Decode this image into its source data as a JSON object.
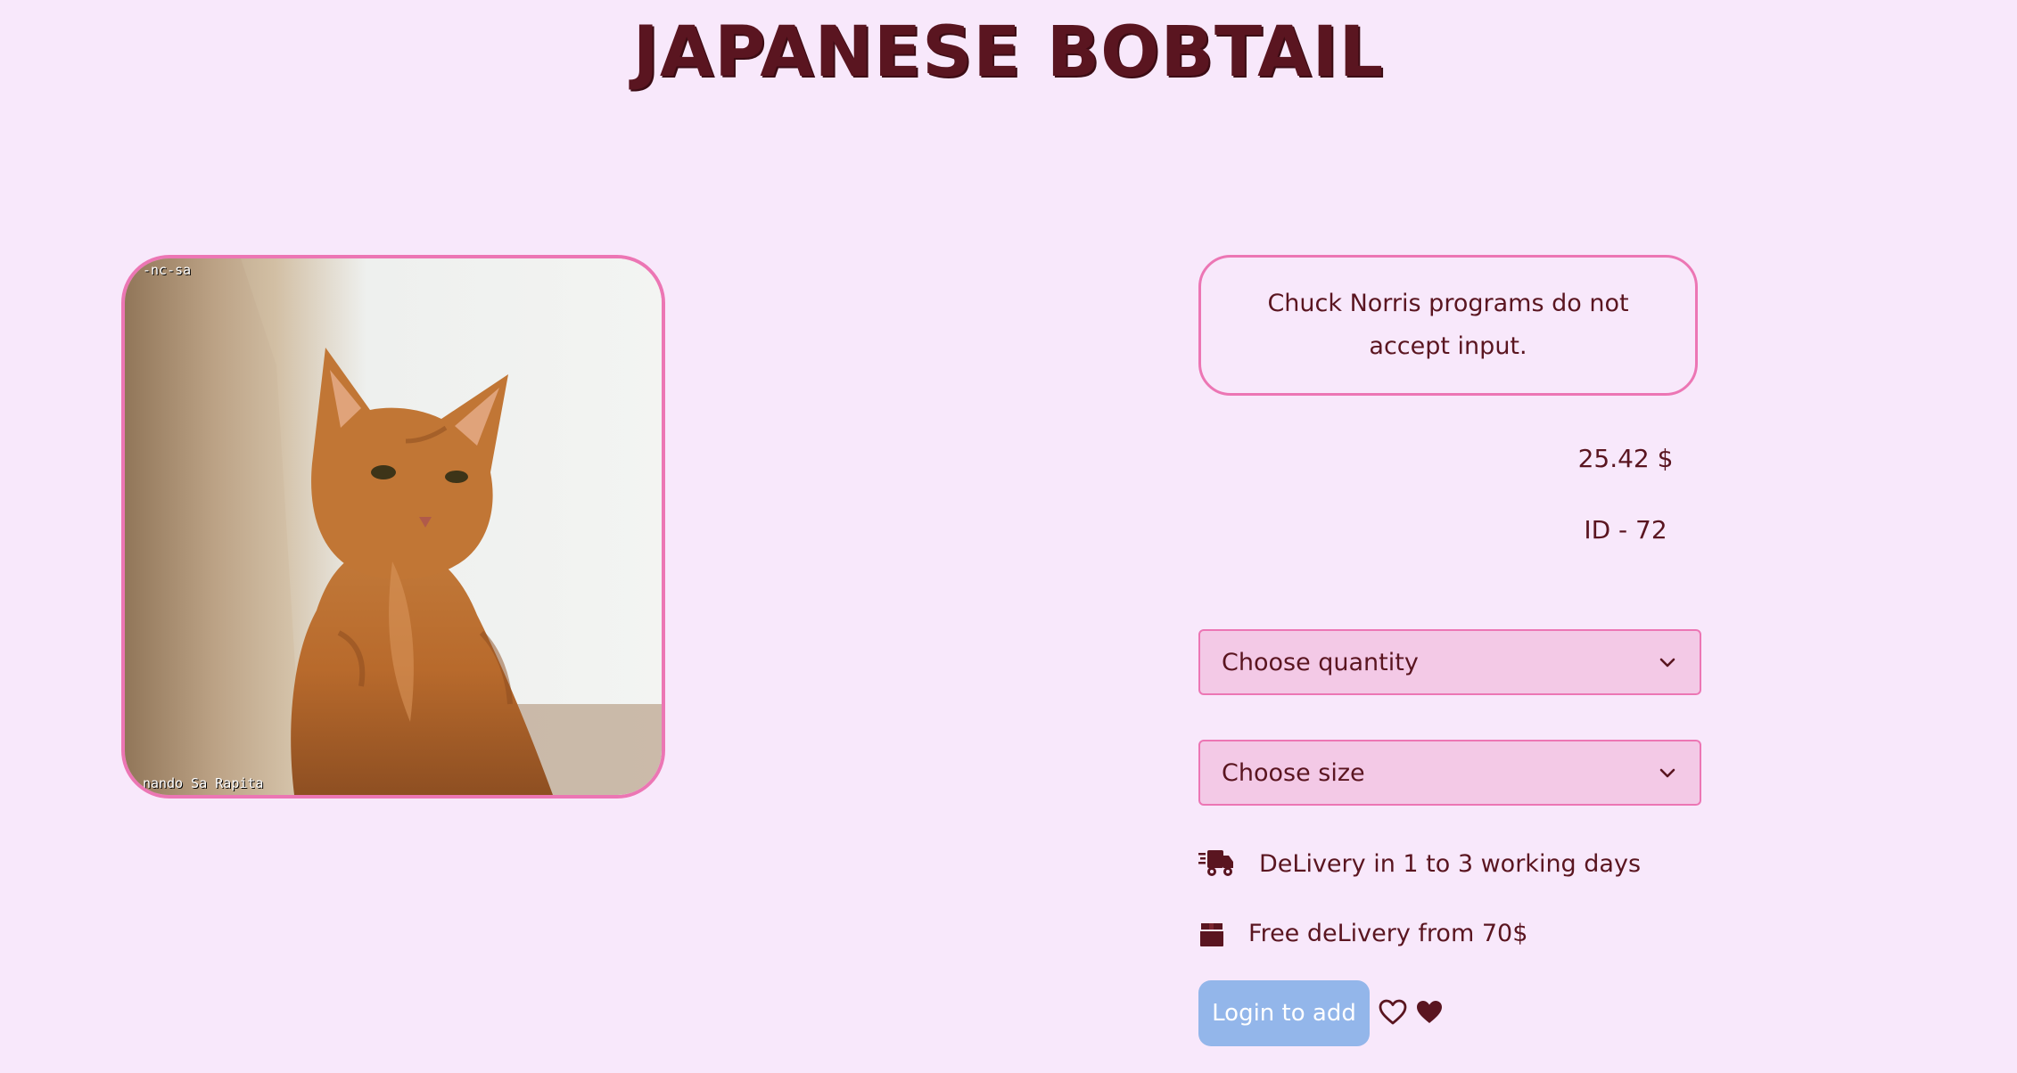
{
  "page": {
    "title": "JAPANESE BOBTAIL"
  },
  "image": {
    "watermark_top": "-nc-sa",
    "watermark_bottom": "nando Sa Rapita",
    "border_color": "#ec76b4"
  },
  "product": {
    "quote": "Chuck Norris programs do not accept input.",
    "price": "25.42 $",
    "id": "ID - 72"
  },
  "selects": {
    "quantity_label": "Choose quantity",
    "size_label": "Choose size"
  },
  "info": {
    "delivery_text": "DeLivery in 1 to 3 working days",
    "free_delivery_text": "Free deLivery from 70$",
    "delivery_icon": "truck-fast-icon",
    "free_delivery_icon": "box-icon"
  },
  "actions": {
    "login_label": "Login to add",
    "favorite_outline_icon": "heart-outline-icon",
    "favorite_filled_icon": "heart-filled-icon"
  },
  "colors": {
    "background": "#f8e8fb",
    "text": "#5a1520",
    "accent": "#ec76b4",
    "select_bg": "#f3c9e6",
    "button_bg": "#93b6ea"
  }
}
